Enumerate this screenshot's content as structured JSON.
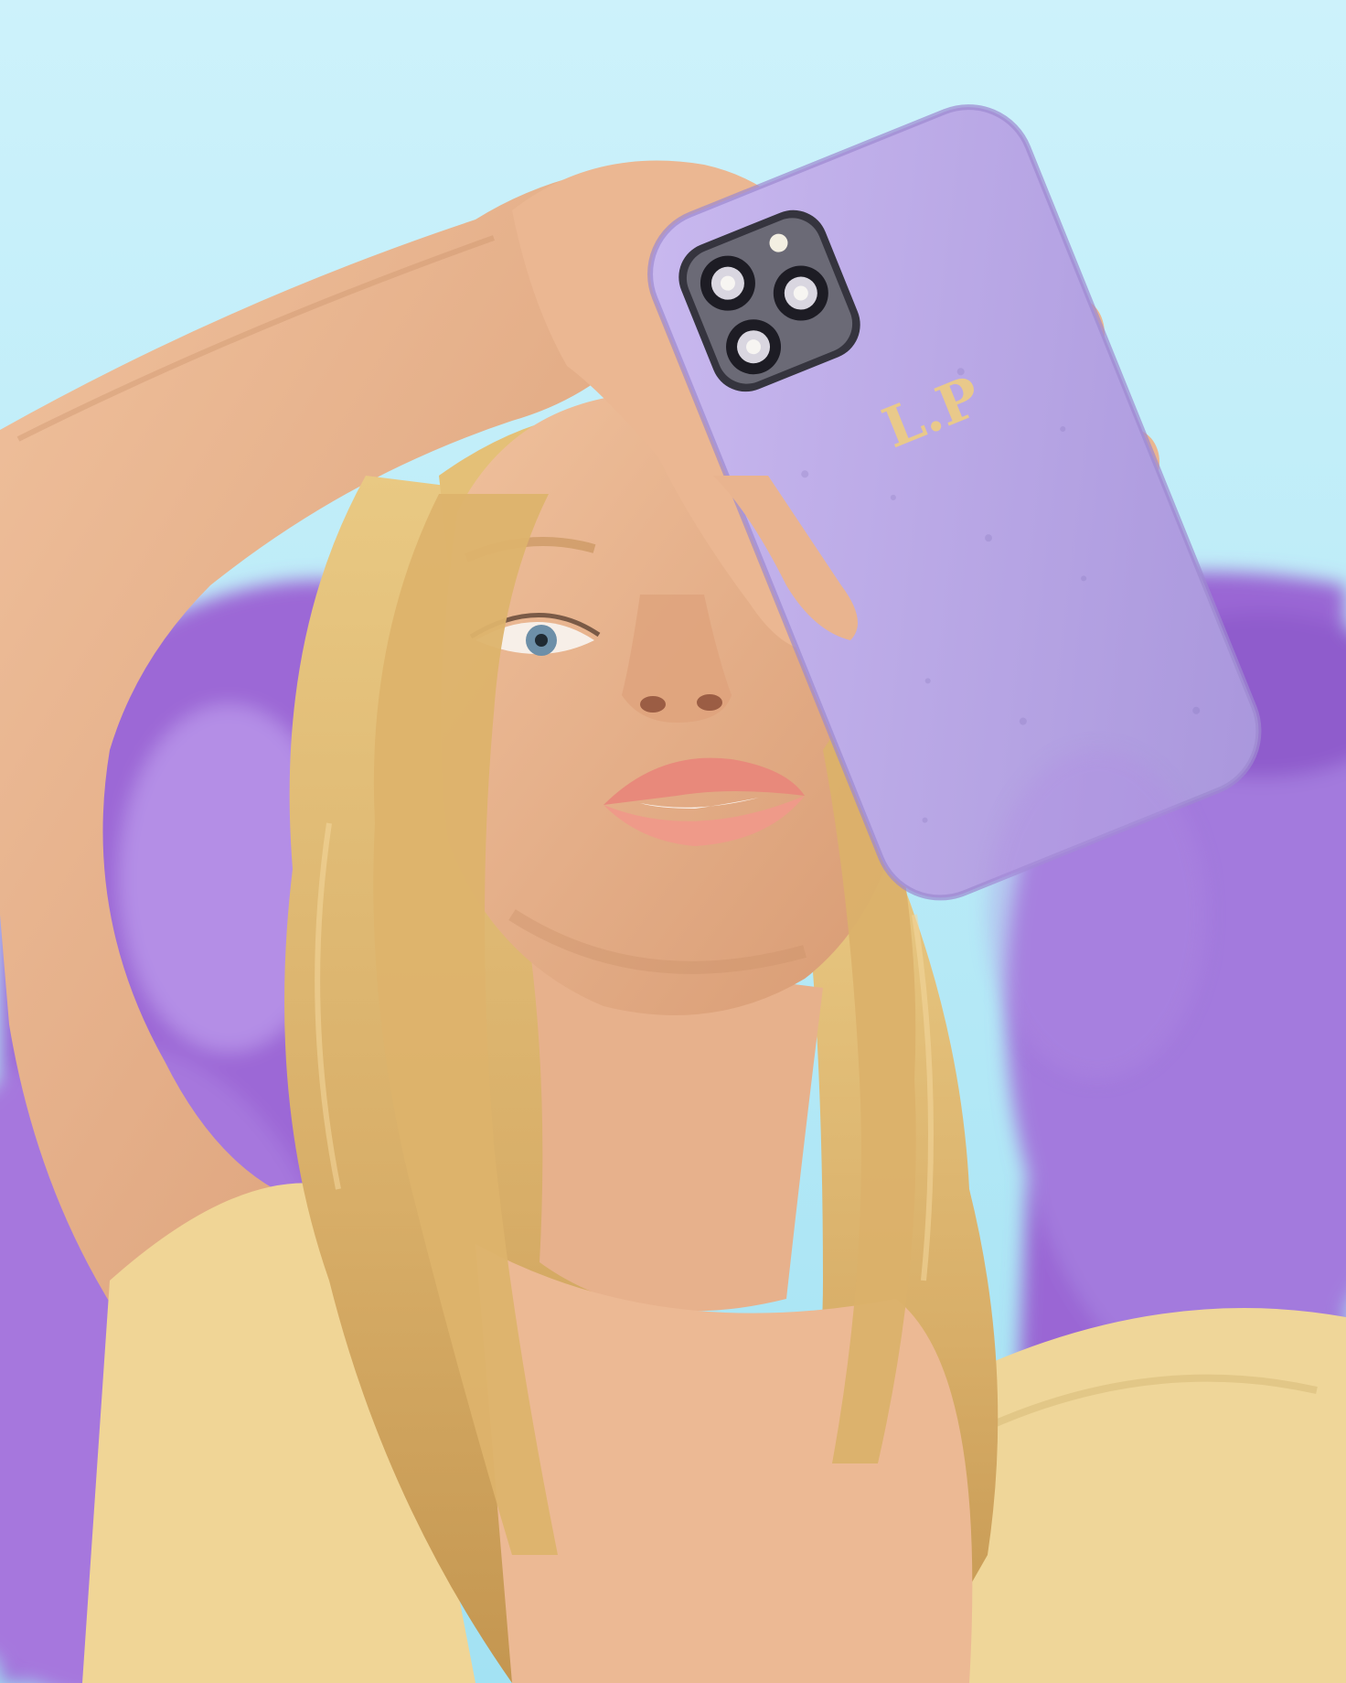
{
  "photo": {
    "subject": "woman-holding-phone-case",
    "setting": "lavender-field",
    "colors": {
      "sky_top": "#c9f0fb",
      "sky_bottom": "#a6e4f4",
      "lavender": "#9d6ad8",
      "lavender_light": "#b892e8",
      "phone_case": "#b9a8e6",
      "phone_case_shadow": "#9b88cf",
      "skin": "#e9b48f",
      "skin_shadow": "#c98e68",
      "hair": "#e6c27a",
      "hair_dark": "#c79a55",
      "dress": "#f1d99a",
      "lips": "#e88f80",
      "camera_module": "#3a3a44",
      "monogram_gold": "#e9c98a"
    },
    "icons": [
      "phone-case-icon",
      "camera-lens-icon"
    ]
  },
  "phone_case": {
    "monogram": "L.P"
  }
}
